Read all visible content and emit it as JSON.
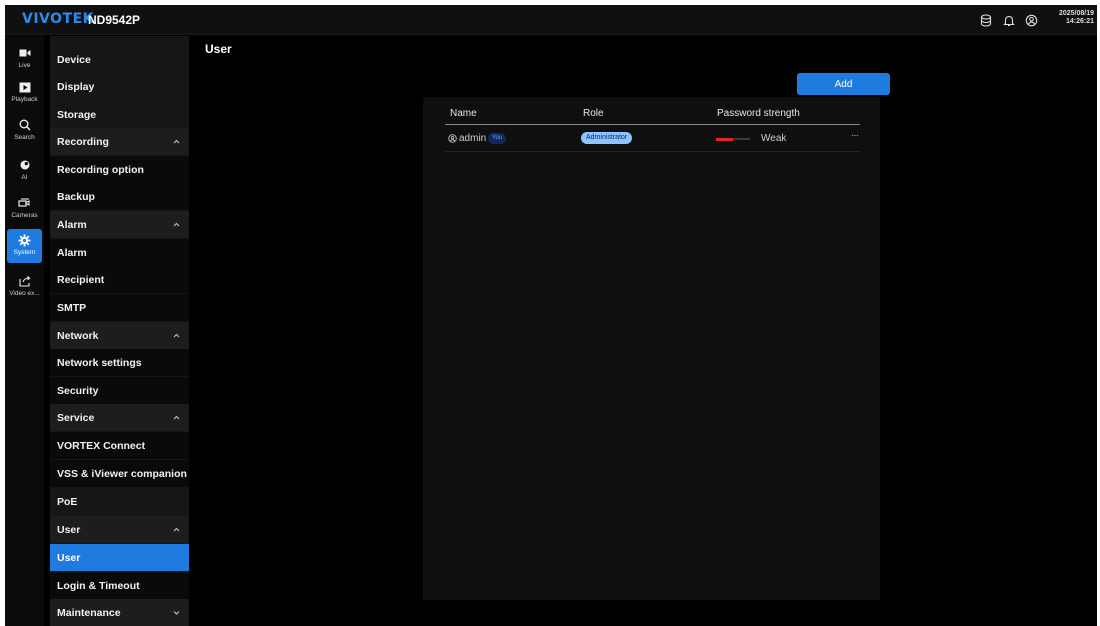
{
  "header": {
    "logo": "VIVOTEK",
    "model": "ND9542P",
    "date": "2025/08/19",
    "time": "14:26:21",
    "icons": [
      "storage-icon",
      "bell-icon",
      "account-icon"
    ]
  },
  "rail": [
    {
      "label": "Live",
      "icon": "video-camera-icon"
    },
    {
      "label": "Playback",
      "icon": "playback-icon"
    },
    {
      "label": "Search",
      "icon": "search-icon"
    },
    {
      "label": "AI",
      "icon": "ai-icon"
    },
    {
      "label": "Cameras",
      "icon": "cameras-icon"
    },
    {
      "label": "System",
      "icon": "gear-icon",
      "active": true
    },
    {
      "label": "Video ex...",
      "icon": "export-icon"
    }
  ],
  "menu": [
    {
      "label": "Device",
      "type": "item"
    },
    {
      "label": "Display",
      "type": "item"
    },
    {
      "label": "Storage",
      "type": "item"
    },
    {
      "label": "Recording",
      "type": "section",
      "expanded": true
    },
    {
      "label": "Recording option",
      "type": "sub"
    },
    {
      "label": "Backup",
      "type": "sub"
    },
    {
      "label": "Alarm",
      "type": "section",
      "expanded": true
    },
    {
      "label": "Alarm",
      "type": "sub"
    },
    {
      "label": "Recipient",
      "type": "sub"
    },
    {
      "label": "SMTP",
      "type": "sub"
    },
    {
      "label": "Network",
      "type": "section",
      "expanded": true
    },
    {
      "label": "Network settings",
      "type": "sub"
    },
    {
      "label": "Security",
      "type": "sub"
    },
    {
      "label": "Service",
      "type": "section",
      "expanded": true
    },
    {
      "label": "VORTEX Connect",
      "type": "sub"
    },
    {
      "label": "VSS & iViewer companion",
      "type": "sub"
    },
    {
      "label": "PoE",
      "type": "item"
    },
    {
      "label": "User",
      "type": "section",
      "expanded": true
    },
    {
      "label": "User",
      "type": "sub",
      "active": true
    },
    {
      "label": "Login & Timeout",
      "type": "sub"
    },
    {
      "label": "Maintenance",
      "type": "section",
      "expanded": false
    }
  ],
  "main": {
    "title": "User",
    "add_label": "Add",
    "columns": [
      "Name",
      "Role",
      "Password strength"
    ],
    "rows": [
      {
        "name": "admin",
        "you_badge": "You",
        "role": "Administrator",
        "strength": "Weak",
        "strength_level": 0.5,
        "more": "···"
      }
    ]
  },
  "colors": {
    "accent": "#1f7be0",
    "logo": "#2a8ee8",
    "weak": "#e0262a",
    "role_badge": "#8fc3ff"
  }
}
